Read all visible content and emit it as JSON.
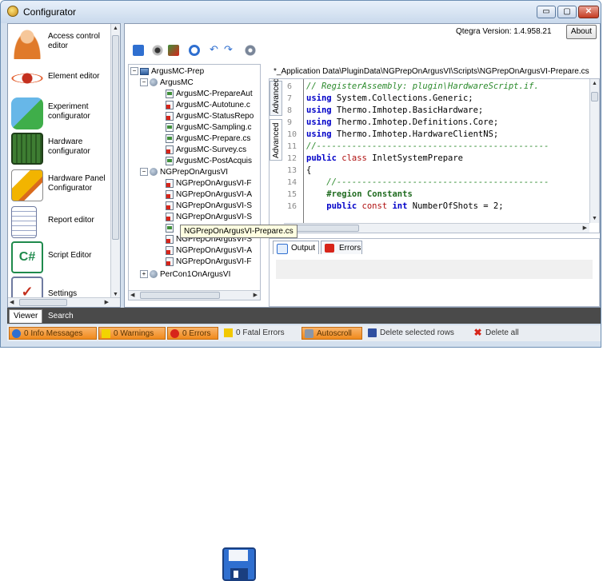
{
  "window": {
    "title": "Configurator",
    "version_label": "Qtegra Version: 1.4.958.21",
    "about_button": "About",
    "controls": {
      "minimize": "▭",
      "maximize": "▢",
      "close": "✕"
    }
  },
  "nav": {
    "items": [
      {
        "label": "Access control editor",
        "icon": "user-lock-icon",
        "color": "#e07a2a"
      },
      {
        "label": "Element editor",
        "icon": "atom-icon",
        "color": "#c4301e"
      },
      {
        "label": "Experiment configurator",
        "icon": "puzzle-icon",
        "color": "#2e8bc7"
      },
      {
        "label": "Hardware configurator",
        "icon": "circuit-board-icon",
        "color": "#3e7d32"
      },
      {
        "label": "Hardware Panel Configurator",
        "icon": "pencil-icon",
        "color": "#f2b400"
      },
      {
        "label": "Report editor",
        "icon": "report-icon",
        "color": "#7a5ac8"
      },
      {
        "label": "Script Editor",
        "icon": "csharp-script-icon",
        "color": "#1f8a4c"
      },
      {
        "label": "Settings",
        "icon": "settings-checklist-icon",
        "color": "#c4301e"
      }
    ]
  },
  "toolbar": {
    "buttons": [
      "save-icon",
      "view-icon",
      "compile-icon",
      "refresh-icon",
      "undo-icon",
      "redo-icon",
      "settings-icon"
    ]
  },
  "tree": {
    "root": "ArgusMC-Prep",
    "group1": {
      "label": "ArgusMC",
      "files": [
        {
          "name": "ArgusMC-PrepareAut",
          "status": "ok"
        },
        {
          "name": "ArgusMC-Autotune.c",
          "status": "err"
        },
        {
          "name": "ArgusMC-StatusRepo",
          "status": "err"
        },
        {
          "name": "ArgusMC-Sampling.c",
          "status": "ok"
        },
        {
          "name": "ArgusMC-Prepare.cs",
          "status": "ok"
        },
        {
          "name": "ArgusMC-Survey.cs",
          "status": "err"
        },
        {
          "name": "ArgusMC-PostAcquis",
          "status": "ok"
        }
      ]
    },
    "group2": {
      "label": "NGPrepOnArgusVI",
      "files": [
        {
          "name": "NGPrepOnArgusVI-F",
          "status": "err"
        },
        {
          "name": "NGPrepOnArgusVI-A",
          "status": "err"
        },
        {
          "name": "NGPrepOnArgusVI-S",
          "status": "err"
        },
        {
          "name": "NGPrepOnArgusVI-S",
          "status": "err"
        },
        {
          "name": "NGPrepOnArgusVI-Prepare.cs",
          "status": "ok"
        },
        {
          "name": "NGPrepOnArgusVI-S",
          "status": "err"
        },
        {
          "name": "NGPrepOnArgusVI-A",
          "status": "err"
        },
        {
          "name": "NGPrepOnArgusVI-F",
          "status": "err"
        }
      ]
    },
    "group3": {
      "label": "PerCon1OnArgusVI"
    },
    "tooltip": "NGPrepOnArgusVI-Prepare.cs"
  },
  "editor": {
    "file_path": "*_Application Data\\PluginData\\NGPrepOnArgusVI\\Scripts\\NGPrepOnArgusVI-Prepare.cs",
    "side_tabs": [
      "Advanced",
      "Advanced"
    ],
    "line_numbers": [
      "6",
      "7",
      "8",
      "9",
      "10",
      "11",
      "12",
      "13",
      "14",
      "15",
      "16"
    ],
    "lines": {
      "l6": "// RegisterAssembly: plugin\\HardwareScript.if.",
      "l7_kw": "using",
      "l7_rest": " System.Collections.Generic;",
      "l8_kw": "using",
      "l8_rest": " Thermo.Imhotep.BasicHardware;",
      "l9_kw": "using",
      "l9_rest": " Thermo.Imhotep.Definitions.Core;",
      "l10_kw": "using",
      "l10_rest": " Thermo.Imhotep.HardwareClientNS;",
      "l11": "//----------------------------------------------",
      "l12_kw1": "public",
      "l12_kw2": " class",
      "l12_rest": " InletSystemPrepare",
      "l13": "{",
      "l14": "    //------------------------------------------",
      "l15_kw": "    #region",
      "l15_rest": " Constants",
      "l16_kw1": "    public",
      "l16_kw2": " const",
      "l16_kw3": " int",
      "l16_rest": " NumberOfShots = 2;"
    }
  },
  "output": {
    "tabs": [
      "Output",
      "Errors"
    ]
  },
  "bottom_tabs": [
    "Viewer",
    "Search"
  ],
  "status": {
    "info": "0 Info Messages",
    "warnings": "0 Warnings",
    "errors": "0 Errors",
    "fatal": "0 Fatal Errors",
    "autoscroll": "Autoscroll",
    "delete_selected": "Delete selected rows",
    "delete_all": "Delete all"
  },
  "colors": {
    "accent": "#f08a1c",
    "error": "#d7251a",
    "ok": "#3f8f3a",
    "save_blue": "#2f6fd0"
  }
}
